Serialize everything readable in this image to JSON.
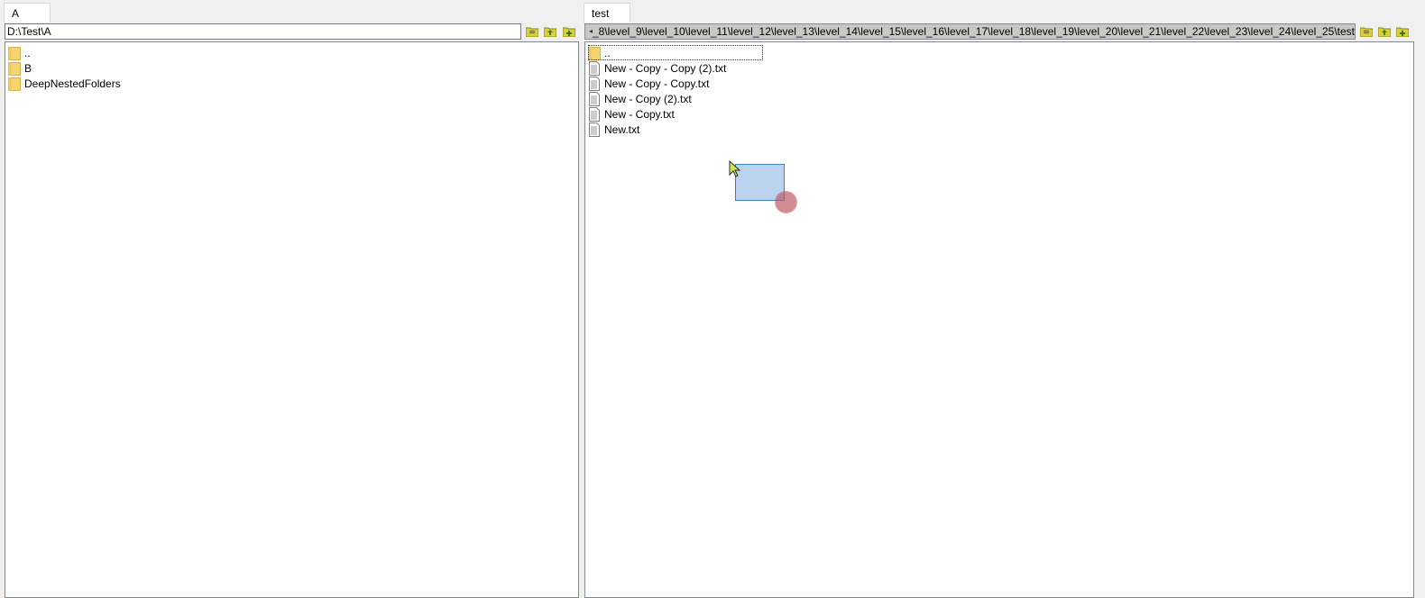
{
  "left": {
    "tab_label": "A",
    "path": "D:\\Test\\A",
    "items": [
      {
        "name": "..",
        "kind": "folder"
      },
      {
        "name": "B",
        "kind": "folder"
      },
      {
        "name": "DeepNestedFolders",
        "kind": "folder"
      }
    ]
  },
  "right": {
    "tab_label": "test",
    "path": "_8\\level_9\\level_10\\level_11\\level_12\\level_13\\level_14\\level_15\\level_16\\level_17\\level_18\\level_19\\level_20\\level_21\\level_22\\level_23\\level_24\\level_25\\test",
    "items": [
      {
        "name": "..",
        "kind": "folder"
      },
      {
        "name": "New - Copy - Copy (2).txt",
        "kind": "file"
      },
      {
        "name": "New - Copy - Copy.txt",
        "kind": "file"
      },
      {
        "name": "New - Copy (2).txt",
        "kind": "file"
      },
      {
        "name": "New - Copy.txt",
        "kind": "file"
      },
      {
        "name": "New.txt",
        "kind": "file"
      }
    ]
  },
  "icons": {
    "folder": "folder-icon",
    "file": "text-file-icon",
    "toolbar": [
      "browse-folder-icon",
      "parent-folder-icon",
      "new-folder-icon"
    ]
  },
  "colors": {
    "folder": "#f5d473",
    "folder_edge": "#d8b04b",
    "toolbar_icon": "#c9c01e",
    "drag_fill": "#bcd3ef",
    "drag_border": "#3c7fb1"
  }
}
